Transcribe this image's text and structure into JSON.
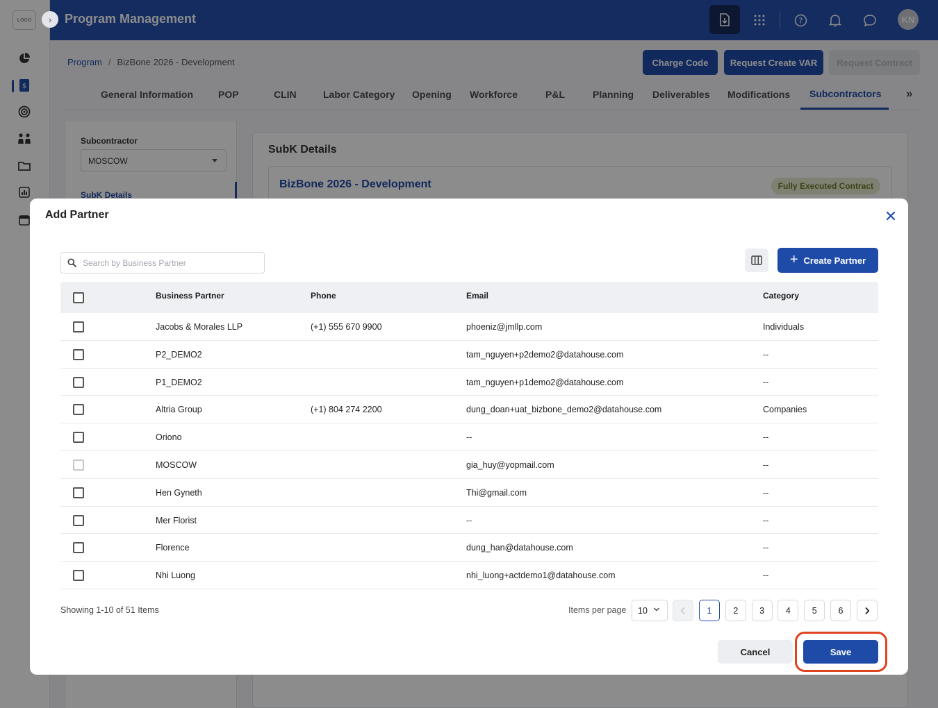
{
  "app": {
    "logo_text": "LOGO",
    "title": "Program Management",
    "avatar_initials": "KN"
  },
  "breadcrumb": {
    "root": "Program",
    "separator": "/",
    "current": "BizBone 2026 - Development"
  },
  "header_buttons": {
    "charge_code": "Charge Code",
    "request_create_var": "Request Create VAR",
    "request_contract": "Request Contract"
  },
  "tabs": [
    {
      "label": "General Information"
    },
    {
      "label": "POP"
    },
    {
      "label": "CLIN"
    },
    {
      "label": "Labor Category"
    },
    {
      "label": "Opening"
    },
    {
      "label": "Workforce"
    },
    {
      "label": "P&L"
    },
    {
      "label": "Planning"
    },
    {
      "label": "Deliverables"
    },
    {
      "label": "Modifications"
    },
    {
      "label": "Subcontractors"
    }
  ],
  "tabs_more": "»",
  "left_panel": {
    "label": "Subcontractor",
    "selected": "MOSCOW",
    "link": "SubK Details"
  },
  "right_panel": {
    "title": "SubK Details",
    "card_title": "BizBone 2026 - Development",
    "status": "Fully Executed Contract"
  },
  "modal": {
    "title": "Add Partner",
    "search_placeholder": "Search by Business Partner",
    "create_button": "Create Partner",
    "columns": {
      "partner": "Business Partner",
      "phone": "Phone",
      "email": "Email",
      "category": "Category"
    },
    "rows": [
      {
        "partner": "Jacobs & Morales LLP",
        "phone": "(+1) 555 670 9900",
        "email": "phoeniz@jmllp.com",
        "category": "Individuals"
      },
      {
        "partner": "P2_DEMO2",
        "phone": "",
        "email": "tam_nguyen+p2demo2@datahouse.com",
        "category": "--"
      },
      {
        "partner": "P1_DEMO2",
        "phone": "",
        "email": "tam_nguyen+p1demo2@datahouse.com",
        "category": "--"
      },
      {
        "partner": "Altria Group",
        "phone": "(+1) 804 274 2200",
        "email": "dung_doan+uat_bizbone_demo2@datahouse.com",
        "category": "Companies"
      },
      {
        "partner": "Oriono",
        "phone": "",
        "email": "--",
        "category": "--"
      },
      {
        "partner": "MOSCOW",
        "phone": "",
        "email": "gia_huy@yopmail.com",
        "category": "--"
      },
      {
        "partner": "Hen Gyneth",
        "phone": "",
        "email": "Thi@gmail.com",
        "category": "--"
      },
      {
        "partner": "Mer Florist",
        "phone": "",
        "email": "--",
        "category": "--"
      },
      {
        "partner": "Florence",
        "phone": "",
        "email": "dung_han@datahouse.com",
        "category": "--"
      },
      {
        "partner": "Nhi Luong",
        "phone": "",
        "email": "nhi_luong+actdemo1@datahouse.com",
        "category": "--"
      }
    ],
    "showing": "Showing 1-10 of 51 Items",
    "items_per_page_label": "Items per page",
    "items_per_page": "10",
    "pages": [
      "1",
      "2",
      "3",
      "4",
      "5",
      "6"
    ],
    "current_page": "1",
    "cancel": "Cancel",
    "save": "Save"
  },
  "colors": {
    "brand": "#2550b0",
    "primary_button": "#1f4ba8",
    "highlight": "#e0431f",
    "status_badge_bg": "#e6eccf"
  }
}
